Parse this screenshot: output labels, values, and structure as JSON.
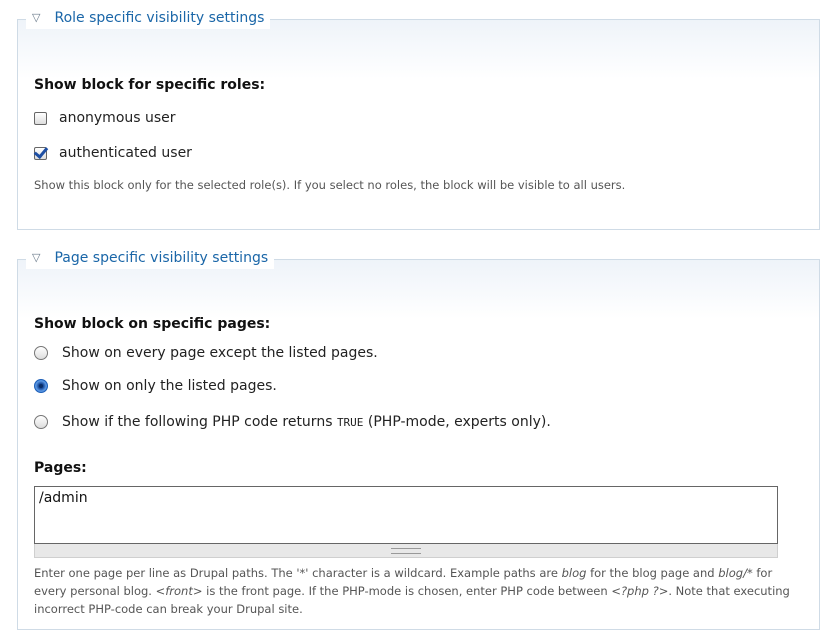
{
  "role_fieldset": {
    "legend": "Role specific visibility settings",
    "heading": "Show block for specific roles:",
    "roles": [
      {
        "label": "anonymous user",
        "checked": false
      },
      {
        "label": "authenticated user",
        "checked": true
      }
    ],
    "description": "Show this block only for the selected role(s). If you select no roles, the block will be visible to all users."
  },
  "page_fieldset": {
    "legend": "Page specific visibility settings",
    "heading": "Show block on specific pages:",
    "options": [
      {
        "label": "Show on every page except the listed pages.",
        "selected": false
      },
      {
        "label": "Show on only the listed pages.",
        "selected": true
      },
      {
        "label_pre": "Show if the following PHP code returns",
        "label_code": "TRUE",
        "label_post": "(PHP-mode, experts only).",
        "selected": false
      }
    ],
    "pages_label": "Pages:",
    "pages_value": "/admin",
    "description": {
      "p1": "Enter one page per line as Drupal paths. The '*' character is a wildcard. Example paths are ",
      "em1": "blog",
      "p2": " for the blog page and ",
      "em2": "blog/*",
      "p3": " for every personal blog. ",
      "em3": "<front>",
      "p4": " is the front page. If the PHP-mode is chosen, enter PHP code between ",
      "em4": "<?php ?>",
      "p5": ". Note that executing incorrect PHP-code can break your Drupal site."
    }
  }
}
